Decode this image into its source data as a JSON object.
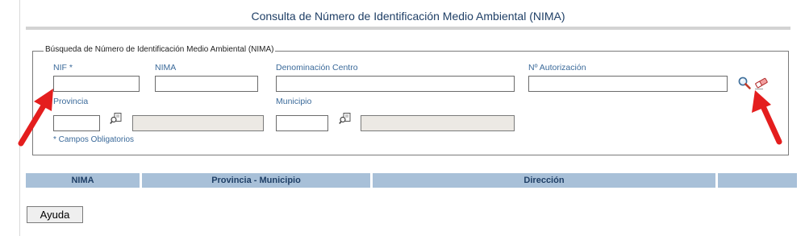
{
  "title": "Consulta de Número de Identificación Medio Ambiental (NIMA)",
  "legend": "Búsqueda de Número de Identificación Medio Ambiental (NIMA)",
  "fields": {
    "nif": {
      "label": "NIF *",
      "value": ""
    },
    "nima": {
      "label": "NIMA",
      "value": ""
    },
    "denominacion": {
      "label": "Denominación Centro",
      "value": ""
    },
    "autorizacion": {
      "label": "Nº Autorización",
      "value": ""
    },
    "provincia": {
      "label": "Provincia",
      "code": "",
      "name": ""
    },
    "municipio": {
      "label": "Municipio",
      "code": "",
      "name": ""
    }
  },
  "required_note": "* Campos Obligatorios",
  "table": {
    "columns": [
      "NIMA",
      "Provincia - Municipio",
      "Dirección",
      ""
    ]
  },
  "buttons": {
    "help": "Ayuda"
  },
  "icons": {
    "search": "magnifier-icon",
    "clear": "eraser-icon",
    "lookup": "lookup-icon"
  },
  "colors": {
    "header_bg": "#a8c0d8",
    "title": "#1f3f66",
    "label": "#3b6a9a",
    "arrow": "#e41e1e"
  }
}
